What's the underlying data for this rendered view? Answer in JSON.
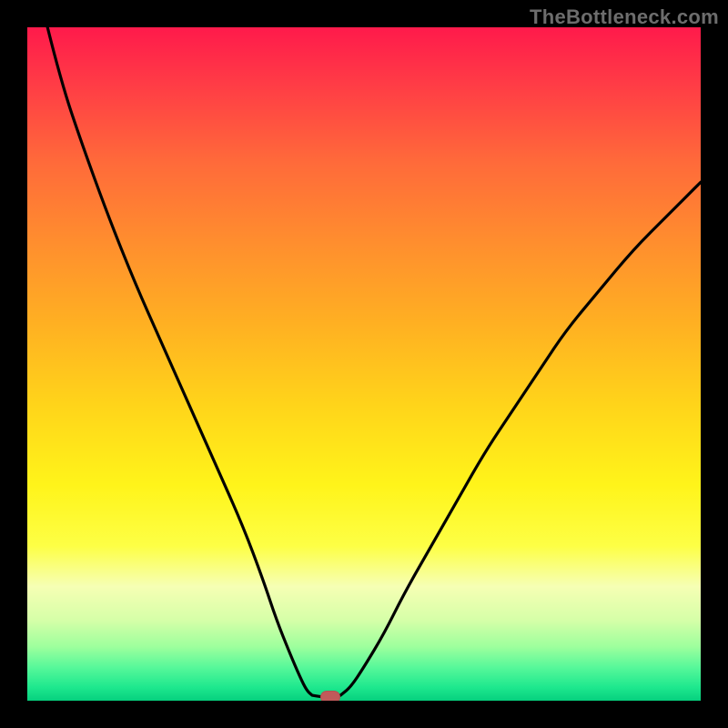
{
  "watermark": "TheBottleneck.com",
  "chart_data": {
    "type": "line",
    "title": "",
    "xlabel": "",
    "ylabel": "",
    "xlim": [
      0,
      100
    ],
    "ylim": [
      0,
      100
    ],
    "grid": false,
    "legend": false,
    "series": [
      {
        "name": "left-branch",
        "x": [
          3,
          5,
          8,
          12,
          16,
          20,
          24,
          28,
          32,
          35,
          37,
          39,
          40.5,
          41.5,
          42.3
        ],
        "y": [
          100,
          92,
          83,
          72,
          62,
          53,
          44,
          35,
          26,
          18,
          12,
          7,
          3.5,
          1.5,
          0.8
        ]
      },
      {
        "name": "flat-min",
        "x": [
          42.3,
          43.5,
          44.5,
          45.5,
          46.5
        ],
        "y": [
          0.8,
          0.6,
          0.5,
          0.6,
          0.8
        ]
      },
      {
        "name": "right-branch",
        "x": [
          46.5,
          48,
          50,
          53,
          56,
          60,
          64,
          68,
          72,
          76,
          80,
          85,
          90,
          95,
          100
        ],
        "y": [
          0.8,
          2,
          5,
          10,
          16,
          23,
          30,
          37,
          43,
          49,
          55,
          61,
          67,
          72,
          77
        ]
      }
    ],
    "marker": {
      "name": "optimum-point",
      "x": 45,
      "y": 0.5
    },
    "gradient_colors": {
      "top": "#ff1a4b",
      "mid": "#ffd41a",
      "bottom": "#06d07e"
    }
  }
}
